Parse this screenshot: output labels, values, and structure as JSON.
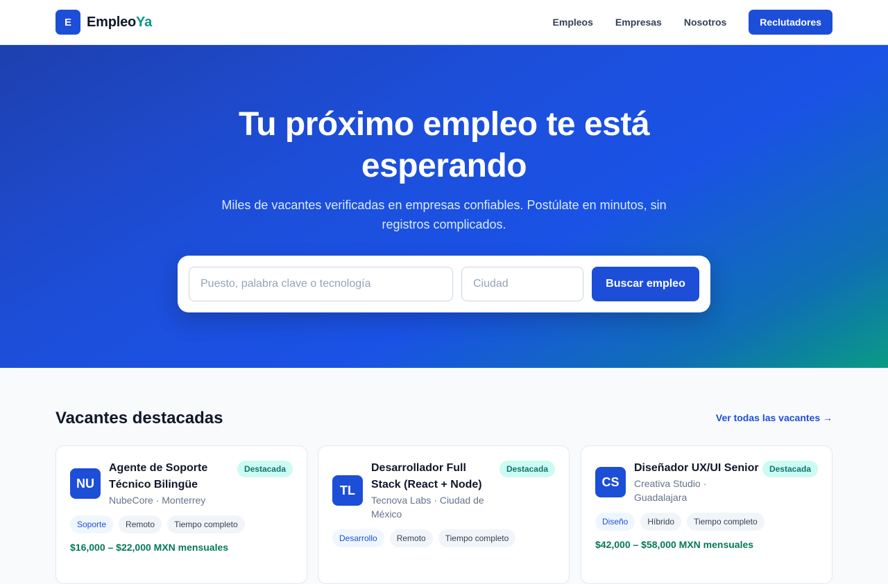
{
  "brand": {
    "mark": "E",
    "name_main": "Empleo",
    "name_accent": "Ya"
  },
  "nav": {
    "items": [
      "Empleos",
      "Empresas",
      "Nosotros"
    ],
    "cta": "Reclutadores"
  },
  "hero": {
    "title": "Tu próximo empleo te está esperando",
    "subtitle": "Miles de vacantes verificadas en empresas confiables. Postúlate en minutos, sin registros complicados.",
    "search": {
      "keyword_placeholder": "Puesto, palabra clave o tecnología",
      "keyword_value": "",
      "city_placeholder": "Ciudad",
      "city_value": "",
      "button_label": "Buscar empleo"
    }
  },
  "featured": {
    "title": "Vacantes destacadas",
    "see_all": "Ver todas las vacantes →",
    "jobs": [
      {
        "initials": "NU",
        "title": "Agente de Soporte Técnico Bilingüe",
        "company": "NubeCore · Monterrey",
        "badge": "Destacada",
        "tags": [
          "Soporte",
          "Remoto",
          "Tiempo completo"
        ],
        "salary": "$16,000 – $22,000 MXN mensuales"
      },
      {
        "initials": "TL",
        "title": "Desarrollador Full Stack (React + Node)",
        "company": "Tecnova Labs · Ciudad de México",
        "badge": "Destacada",
        "tags": [
          "Desarrollo",
          "Remoto",
          "Tiempo completo"
        ],
        "salary": ""
      },
      {
        "initials": "CS",
        "title": "Diseñador UX/UI Senior",
        "company": "Creativa Studio · Guadalajara",
        "badge": "Destacada",
        "tags": [
          "Diseño",
          "Híbrido",
          "Tiempo completo"
        ],
        "salary": "$42,000 – $58,000 MXN mensuales"
      }
    ]
  },
  "colors": {
    "primary": "#1d4ed8",
    "accent": "#0d9488",
    "salary": "#047857",
    "badge_bg": "#ccfbf1"
  }
}
